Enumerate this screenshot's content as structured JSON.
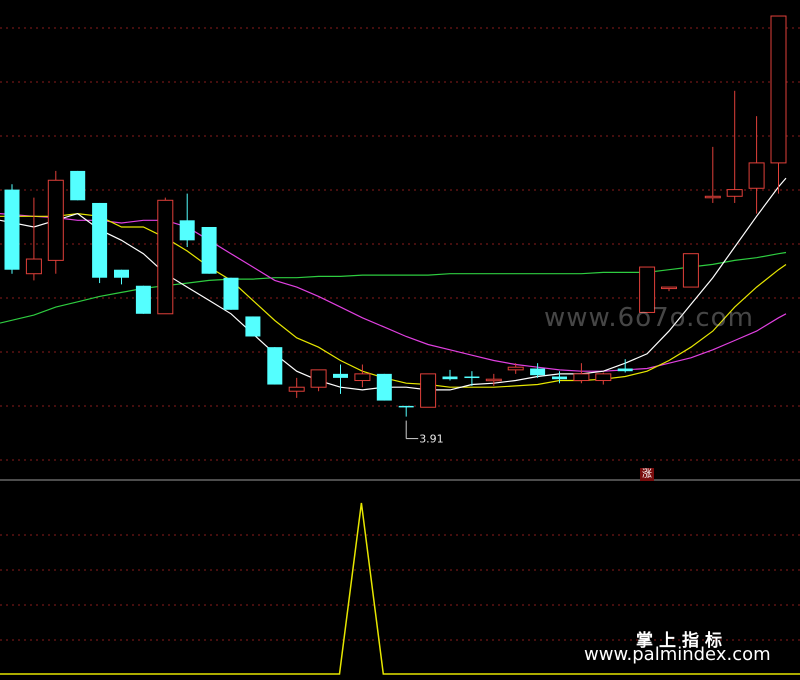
{
  "colors": {
    "up": "#e0403a",
    "down": "#54ffff",
    "ma5": "#ffffff",
    "ma10": "#e6e600",
    "ma20": "#e040e0",
    "ma60": "#2ecc40",
    "grid": "#8a1c1c",
    "separator": "#9a9a9a",
    "indicator": "#e6e600"
  },
  "price_panel": {
    "low_label": "3.91",
    "badge": "涨"
  },
  "watermarks": {
    "main": "www.6o7o.com",
    "cn": "掌上指标",
    "url": "www.palmindex.com"
  },
  "chart_data": {
    "type": "candlestick",
    "candles": [
      {
        "o": 4.68,
        "h": 4.72,
        "l": 4.05,
        "c": 4.08
      },
      {
        "o": 4.05,
        "h": 4.62,
        "l": 4.0,
        "c": 4.16
      },
      {
        "o": 4.15,
        "h": 4.82,
        "l": 4.05,
        "c": 4.75
      },
      {
        "o": 4.82,
        "h": 4.82,
        "l": 4.6,
        "c": 4.6
      },
      {
        "o": 4.58,
        "h": 4.58,
        "l": 3.98,
        "c": 4.02
      },
      {
        "o": 4.08,
        "h": 4.08,
        "l": 3.97,
        "c": 4.02
      },
      {
        "o": 3.96,
        "h": 3.96,
        "l": 3.75,
        "c": 3.75
      },
      {
        "o": 3.75,
        "h": 4.62,
        "l": 3.75,
        "c": 4.6
      },
      {
        "o": 4.45,
        "h": 4.65,
        "l": 4.25,
        "c": 4.3
      },
      {
        "o": 4.4,
        "h": 4.4,
        "l": 4.05,
        "c": 4.05
      },
      {
        "o": 4.02,
        "h": 4.02,
        "l": 3.78,
        "c": 3.78
      },
      {
        "o": 3.73,
        "h": 3.73,
        "l": 3.58,
        "c": 3.58
      },
      {
        "o": 3.5,
        "h": 3.5,
        "l": 3.22,
        "c": 3.22
      },
      {
        "o": 3.17,
        "h": 3.27,
        "l": 3.12,
        "c": 3.2
      },
      {
        "o": 3.2,
        "h": 3.33,
        "l": 3.17,
        "c": 3.33
      },
      {
        "o": 3.3,
        "h": 3.37,
        "l": 3.15,
        "c": 3.27
      },
      {
        "o": 3.25,
        "h": 3.37,
        "l": 3.2,
        "c": 3.3
      },
      {
        "o": 3.3,
        "h": 3.3,
        "l": 3.1,
        "c": 3.1
      },
      {
        "o": 3.06,
        "h": 3.06,
        "l": 2.98,
        "c": 3.05
      },
      {
        "o": 3.05,
        "h": 3.3,
        "l": 3.05,
        "c": 3.3
      },
      {
        "o": 3.28,
        "h": 3.33,
        "l": 3.25,
        "c": 3.26
      },
      {
        "o": 3.28,
        "h": 3.32,
        "l": 3.21,
        "c": 3.27
      },
      {
        "o": 3.26,
        "h": 3.3,
        "l": 3.21,
        "c": 3.26
      },
      {
        "o": 3.33,
        "h": 3.38,
        "l": 3.3,
        "c": 3.35
      },
      {
        "o": 3.34,
        "h": 3.38,
        "l": 3.27,
        "c": 3.29
      },
      {
        "o": 3.28,
        "h": 3.32,
        "l": 3.23,
        "c": 3.26
      },
      {
        "o": 3.25,
        "h": 3.38,
        "l": 3.23,
        "c": 3.3
      },
      {
        "o": 3.25,
        "h": 3.31,
        "l": 3.22,
        "c": 3.3
      },
      {
        "o": 3.34,
        "h": 3.41,
        "l": 3.31,
        "c": 3.32
      },
      {
        "o": 3.76,
        "h": 4.1,
        "l": 3.76,
        "c": 4.1
      },
      {
        "o": 3.95,
        "h": 3.95,
        "l": 3.92,
        "c": 3.95
      },
      {
        "o": 3.95,
        "h": 4.2,
        "l": 3.95,
        "c": 4.2
      },
      {
        "o": 4.62,
        "h": 5.0,
        "l": 4.58,
        "c": 4.63
      },
      {
        "o": 4.63,
        "h": 5.42,
        "l": 4.58,
        "c": 4.68
      },
      {
        "o": 4.69,
        "h": 5.23,
        "l": 4.5,
        "c": 4.88
      },
      {
        "o": 4.88,
        "h": 5.3,
        "l": 4.65,
        "c": 5.98
      }
    ],
    "ma5": [
      4.45,
      4.4,
      4.45,
      4.5,
      4.38,
      4.3,
      4.2,
      4.05,
      3.95,
      3.85,
      3.75,
      3.6,
      3.45,
      3.32,
      3.25,
      3.2,
      3.18,
      3.2,
      3.2,
      3.18,
      3.18,
      3.22,
      3.23,
      3.25,
      3.28,
      3.3,
      3.3,
      3.32,
      3.38,
      3.45,
      3.62,
      3.82,
      4.02,
      4.25,
      4.48,
      4.7
    ],
    "ma10": [
      4.48,
      4.48,
      4.48,
      4.5,
      4.48,
      4.4,
      4.4,
      4.32,
      4.22,
      4.1,
      4.0,
      3.85,
      3.7,
      3.57,
      3.5,
      3.4,
      3.32,
      3.27,
      3.23,
      3.22,
      3.2,
      3.2,
      3.2,
      3.21,
      3.22,
      3.25,
      3.25,
      3.26,
      3.28,
      3.32,
      3.4,
      3.5,
      3.62,
      3.8,
      3.95,
      4.08
    ],
    "ma20": [
      4.5,
      4.48,
      4.47,
      4.45,
      4.45,
      4.43,
      4.45,
      4.45,
      4.4,
      4.3,
      4.2,
      4.1,
      4.0,
      3.95,
      3.88,
      3.8,
      3.72,
      3.65,
      3.58,
      3.52,
      3.48,
      3.44,
      3.4,
      3.37,
      3.35,
      3.33,
      3.32,
      3.32,
      3.33,
      3.34,
      3.38,
      3.42,
      3.48,
      3.55,
      3.62,
      3.72
    ],
    "ma60": [
      3.68,
      3.74,
      3.8,
      3.84,
      3.88,
      3.91,
      3.94,
      3.96,
      3.98,
      4.0,
      4.01,
      4.01,
      4.02,
      4.02,
      4.03,
      4.03,
      4.04,
      4.04,
      4.04,
      4.04,
      4.05,
      4.05,
      4.05,
      4.05,
      4.05,
      4.05,
      4.05,
      4.06,
      4.06,
      4.06,
      4.08,
      4.1,
      4.12,
      4.15,
      4.17,
      4.2
    ],
    "ylim": [
      2.58,
      6.1
    ],
    "indicator": {
      "values": [
        0,
        0,
        0,
        0,
        0,
        0,
        0,
        0,
        0,
        0,
        0,
        0,
        0,
        0,
        0,
        0,
        1,
        0,
        0,
        0,
        0,
        0,
        0,
        0,
        0,
        0,
        0,
        0,
        0,
        0,
        0,
        0,
        0,
        0,
        0,
        0
      ],
      "ylim": [
        0,
        1
      ]
    }
  }
}
